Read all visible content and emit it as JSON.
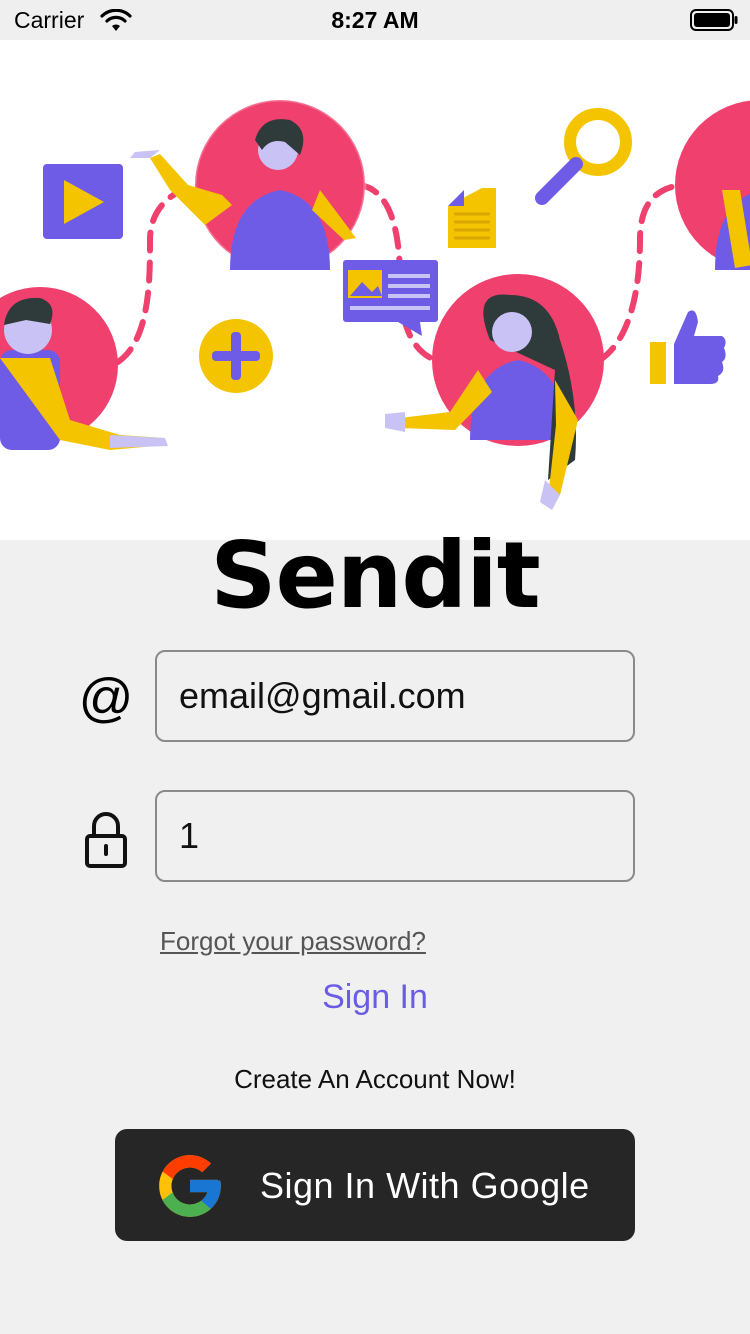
{
  "status_bar": {
    "carrier": "Carrier",
    "time": "8:27 AM"
  },
  "app": {
    "title": "Sendit"
  },
  "form": {
    "email_icon": "@",
    "email_value": "email@gmail.com",
    "password_value": "1",
    "forgot_label": "Forgot your password?",
    "signin_label": "Sign In",
    "create_account_label": "Create An Account Now!",
    "google_label": "Sign In With Google"
  },
  "colors": {
    "accent": "#6b5ce7",
    "hero_pink": "#f0416e",
    "hero_yellow": "#f5c400",
    "hero_purple": "#6e5ce6",
    "google_button_bg": "#262626"
  },
  "icons": [
    "wifi-icon",
    "battery-icon",
    "at-icon",
    "lock-icon",
    "google-icon"
  ]
}
